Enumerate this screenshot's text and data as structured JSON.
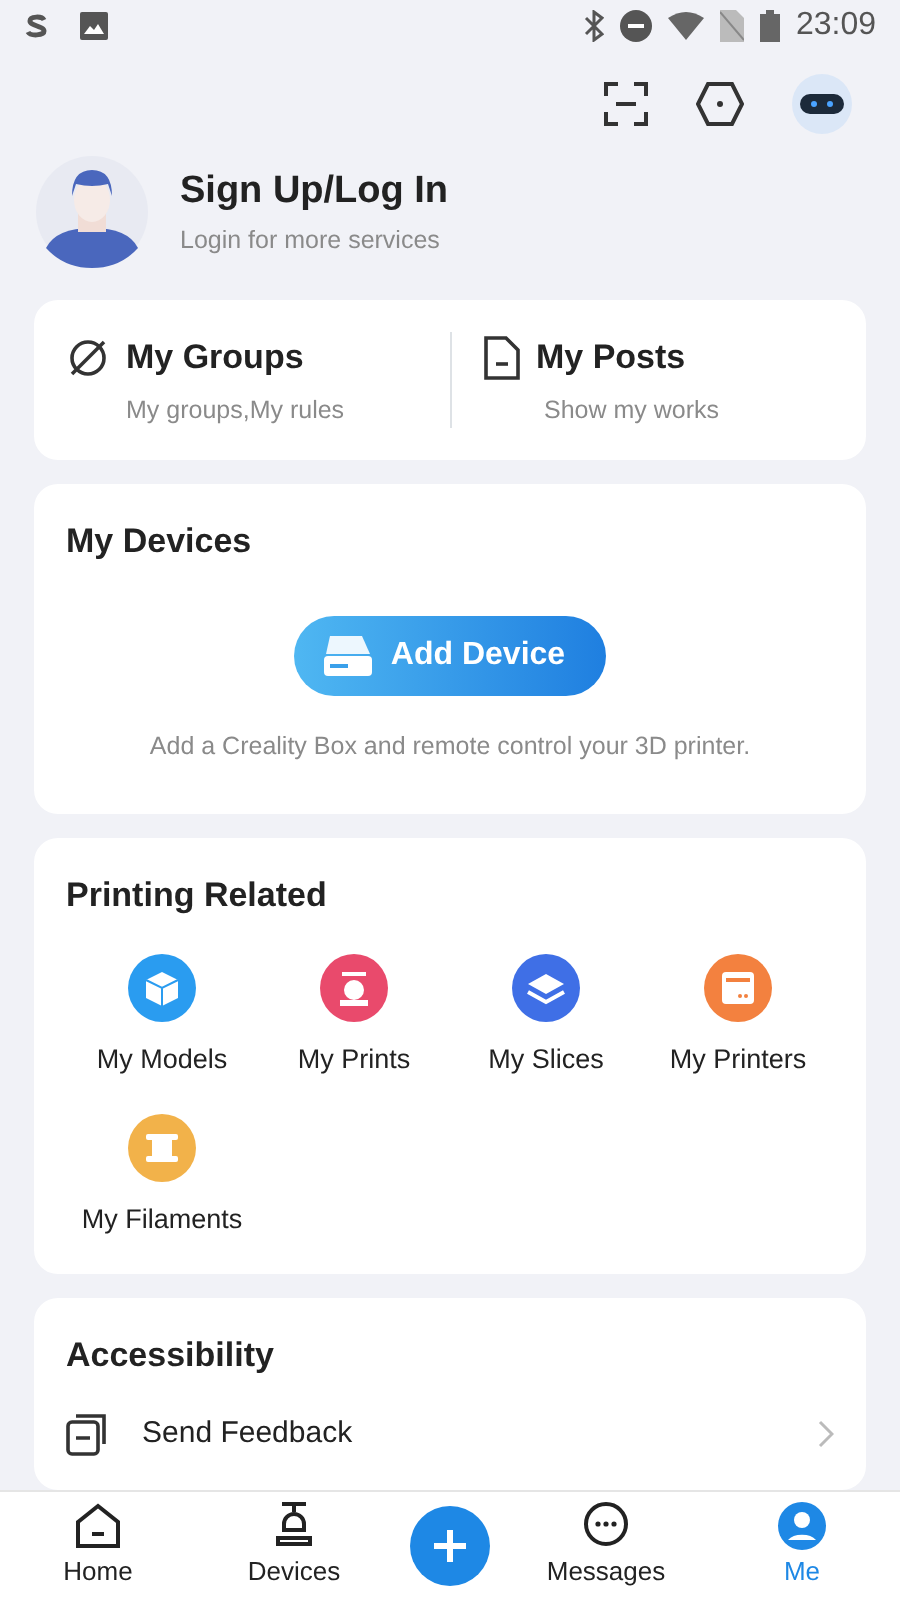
{
  "status_bar": {
    "time": "23:09"
  },
  "profile": {
    "title": "Sign Up/Log In",
    "subtitle": "Login for more services"
  },
  "shortcuts": [
    {
      "kind": "groups",
      "title": "My Groups",
      "subtitle": "My groups,My rules"
    },
    {
      "kind": "posts",
      "title": "My Posts",
      "subtitle": "Show my works"
    }
  ],
  "devices": {
    "title": "My Devices",
    "button": "Add Device",
    "hint": "Add a Creality Box and remote control your 3D printer."
  },
  "printing": {
    "title": "Printing Related",
    "items": [
      {
        "kind": "models",
        "label": "My Models",
        "color": "#2a9cf0"
      },
      {
        "kind": "prints",
        "label": "My Prints",
        "color": "#e94a6c"
      },
      {
        "kind": "slices",
        "label": "My Slices",
        "color": "#3f6fe6"
      },
      {
        "kind": "printers",
        "label": "My Printers",
        "color": "#f3813f"
      },
      {
        "kind": "filaments",
        "label": "My Filaments",
        "color": "#f2b24a"
      }
    ]
  },
  "accessibility": {
    "title": "Accessibility",
    "items": [
      {
        "label": "Send Feedback"
      }
    ]
  },
  "nav": [
    {
      "kind": "home",
      "label": "Home",
      "selected": false
    },
    {
      "kind": "devices",
      "label": "Devices",
      "selected": false
    },
    {
      "kind": "add",
      "selected": false
    },
    {
      "kind": "messages",
      "label": "Messages",
      "selected": false
    },
    {
      "kind": "me",
      "label": "Me",
      "selected": true
    }
  ]
}
